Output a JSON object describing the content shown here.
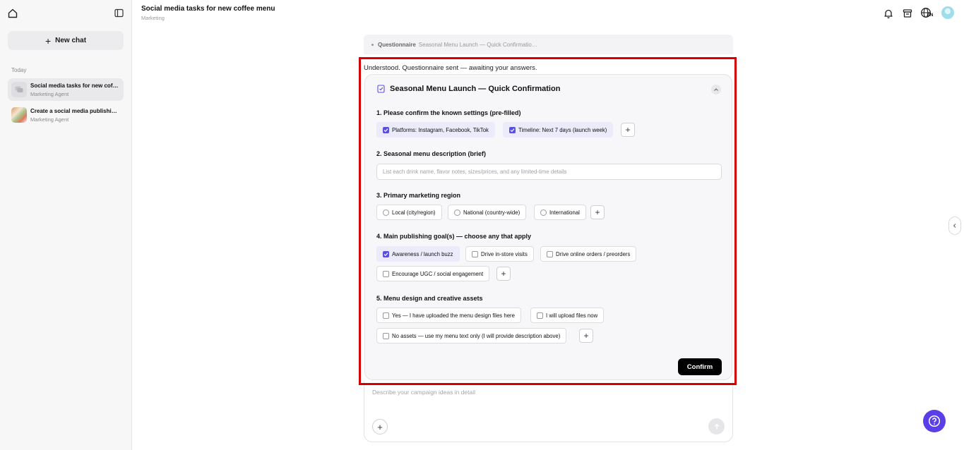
{
  "sidebar": {
    "new_chat_label": "New chat",
    "section_label": "Today",
    "items": [
      {
        "title": "Social media tasks for new coff…",
        "subtitle": "Marketing Agent"
      },
      {
        "title": "Create a social media publishin…",
        "subtitle": "Marketing Agent"
      }
    ]
  },
  "header": {
    "title": "Social media tasks for new coffee menu",
    "subtitle": "Marketing",
    "language": "EN"
  },
  "conversation": {
    "questionnaire_label": "Questionnaire",
    "questionnaire_name": "Seasonal Menu Launch — Quick Confirmatio…",
    "reply_text": "Understood. Questionnaire sent — awaiting your answers."
  },
  "questionnaire": {
    "title": "Seasonal Menu Launch — Quick Confirmation",
    "q1": {
      "title": "1. Please confirm the known settings (pre-filled)",
      "options": [
        {
          "label": "Platforms: Instagram, Facebook, TikTok",
          "checked": true
        },
        {
          "label": "Timeline: Next 7 days (launch week)",
          "checked": true
        }
      ]
    },
    "q2": {
      "title": "2. Seasonal menu description (brief)",
      "placeholder": "List each drink name, flavor notes, sizes/prices, and any limited-time details"
    },
    "q3": {
      "title": "3. Primary marketing region",
      "options": [
        {
          "label": "Local (city/region)",
          "checked": false
        },
        {
          "label": "National (country-wide)",
          "checked": false
        },
        {
          "label": "International",
          "checked": false
        }
      ]
    },
    "q4": {
      "title": "4. Main publishing goal(s) — choose any that apply",
      "options": [
        {
          "label": "Awareness / launch buzz",
          "checked": true
        },
        {
          "label": "Drive in-store visits",
          "checked": false
        },
        {
          "label": "Drive online orders / preorders",
          "checked": false
        },
        {
          "label": "Encourage UGC / social engagement",
          "checked": false
        }
      ]
    },
    "q5": {
      "title": "5. Menu design and creative assets",
      "options": [
        {
          "label": "Yes — I have uploaded the menu design files here",
          "checked": false
        },
        {
          "label": "I will upload files now",
          "checked": false
        },
        {
          "label": "No assets — use my menu text only (I will provide description above)",
          "checked": false
        }
      ]
    },
    "confirm_label": "Confirm"
  },
  "composer": {
    "placeholder": "Describe your campaign ideas in detail"
  },
  "colors": {
    "accent": "#5b4fe0",
    "help_button": "#5a3ee8",
    "highlight_border": "#d40000"
  },
  "icons": [
    "home-icon",
    "sidebar-toggle-icon",
    "bell-icon",
    "archive-icon",
    "globe-icon",
    "chevron-up-icon",
    "chevron-left-icon",
    "help-icon",
    "send-arrow-icon",
    "questionnaire-icon"
  ]
}
